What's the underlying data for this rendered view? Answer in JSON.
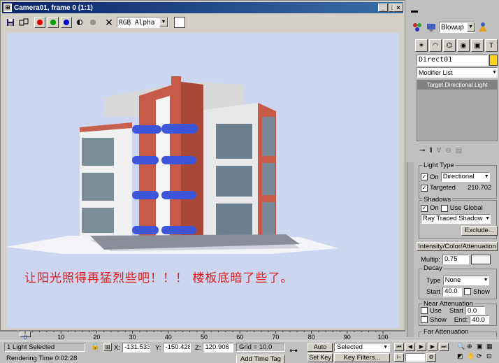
{
  "window": {
    "title": "Camera01, frame 0 (1:1)",
    "channel": "RGB Alpha",
    "buttons": [
      "_",
      "□",
      "×"
    ]
  },
  "render": {
    "caption": "让阳光照得再猛烈些吧！！！ 楼板底暗了些了。"
  },
  "command_panel": {
    "utility_dropdown": "Blowup",
    "object_name": "Direct01",
    "object_color": "#ffd21a",
    "modifier_list": "Modifier List",
    "stack_item": "Target Directional Light",
    "light_type": {
      "header": "Light Type",
      "on_label": "On",
      "type_value": "Directional",
      "targeted_label": "Targeted",
      "targeted_value": "210.702"
    },
    "shadows": {
      "header": "Shadows",
      "on_label": "On",
      "use_global_label": "Use Global",
      "type_value": "Ray Traced Shadow",
      "exclude_label": "Exclude..."
    },
    "intensity": {
      "header": "Intensity/Color/Attenuation",
      "multiplier_label": "Multip:",
      "multiplier_value": "0.75"
    },
    "decay": {
      "header": "Decay",
      "type_label": "Type",
      "type_value": "None",
      "start_label": "Start",
      "start_value": "40.0",
      "show_label": "Show"
    },
    "near_attenuation": {
      "header": "Near Attenuation",
      "use_label": "Use",
      "start_label": "Start",
      "start_value": "0.0",
      "show_label": "Show",
      "end_label": "End:",
      "end_value": "40.0"
    },
    "far_attenuation": {
      "header": "Far Attenuation"
    }
  },
  "timeline": {
    "ticks": [
      "0",
      "10",
      "20",
      "30",
      "40",
      "50",
      "60",
      "70",
      "80",
      "90",
      "100"
    ],
    "current_frame": 0
  },
  "status": {
    "selection": "1 Light Selected",
    "render_time": "Rendering Time  0:02:28",
    "x_label": "X:",
    "x_value": "-131.533",
    "y_label": "Y:",
    "y_value": "-150.428",
    "z_label": "Z:",
    "z_value": "120.906",
    "grid": "Grid = 10.0",
    "add_time_tag": "Add Time Tag",
    "auto_key": "Auto Key",
    "set_key": "Set Key",
    "selected_dropdown": "Selected",
    "key_filters": "Key Filters..."
  }
}
